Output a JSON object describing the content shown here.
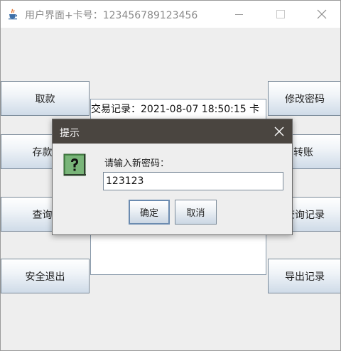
{
  "window": {
    "title": "用户界面+卡号：123456789123456",
    "icon": "java-cup-icon"
  },
  "left_buttons": {
    "withdraw": "取款",
    "deposit": "存款",
    "query": "查询",
    "logout": "安全退出"
  },
  "right_buttons": {
    "change_password": "修改密码",
    "transfer": "转账",
    "query_history": "查询记录",
    "export_history": "导出记录"
  },
  "record": {
    "text": "交易记录：2021-08-07 18:50:15  卡"
  },
  "dialog": {
    "title": "提示",
    "prompt": "请输入新密码：",
    "input_value": "123123",
    "ok_label": "确定",
    "cancel_label": "取消",
    "icon": "question-icon"
  }
}
